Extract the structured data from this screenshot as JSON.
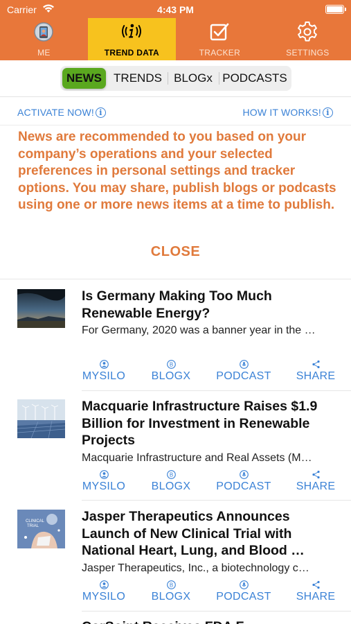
{
  "status_bar": {
    "carrier": "Carrier",
    "time": "4:43 PM"
  },
  "tabs": [
    {
      "label": "ME",
      "icon": "phone-avatar-icon",
      "active": false
    },
    {
      "label": "TREND DATA",
      "icon": "info-broadcast-icon",
      "active": true
    },
    {
      "label": "TRACKER",
      "icon": "checkbox-icon",
      "active": false
    },
    {
      "label": "SETTINGS",
      "icon": "gear-icon",
      "active": false
    }
  ],
  "segments": [
    {
      "label": "NEWS",
      "selected": true
    },
    {
      "label": "TRENDS",
      "selected": false
    },
    {
      "label": "BLOGx",
      "selected": false
    },
    {
      "label": "PODCASTS",
      "selected": false
    }
  ],
  "info": {
    "activate_label": "ACTIVATE NOW!",
    "how_label": "HOW IT WORKS!",
    "message": "News are recommended to you based on your company’s operations and your selected preferences in personal settings and tracker options. You may share, publish blogs or podcasts using one or more news items at a time to publish.",
    "close_label": "CLOSE"
  },
  "news_items": [
    {
      "title": "Is Germany Making Too Much Renewable Energy?",
      "description": "For Germany, 2020 was a banner year in the …",
      "thumbnail": "storm-sky-landscape"
    },
    {
      "title": "Macquarie Infrastructure Raises $1.9 Billion for Investment in Renewable Projects",
      "description": "Macquarie Infrastructure and Real Assets (M…",
      "thumbnail": "solar-wind-farm"
    },
    {
      "title": "Jasper Therapeutics Announces Launch of New Clinical Trial with National Heart, Lung, and Blood …",
      "description": "Jasper Therapeutics, Inc., a biotechnology c…",
      "thumbnail": "clinical-trial"
    },
    {
      "title": "CorSoint Receives FDA F…",
      "description": "",
      "thumbnail": ""
    }
  ],
  "actions": {
    "mysilo": "MYSILO",
    "blogx": "BLOGX",
    "podcast": "PODCAST",
    "share": "SHARE"
  },
  "colors": {
    "header": "#e8773a",
    "active_tab": "#f7c21e",
    "selected_segment": "#5aa81f",
    "link": "#3b82d6",
    "note": "#e07a3c"
  }
}
